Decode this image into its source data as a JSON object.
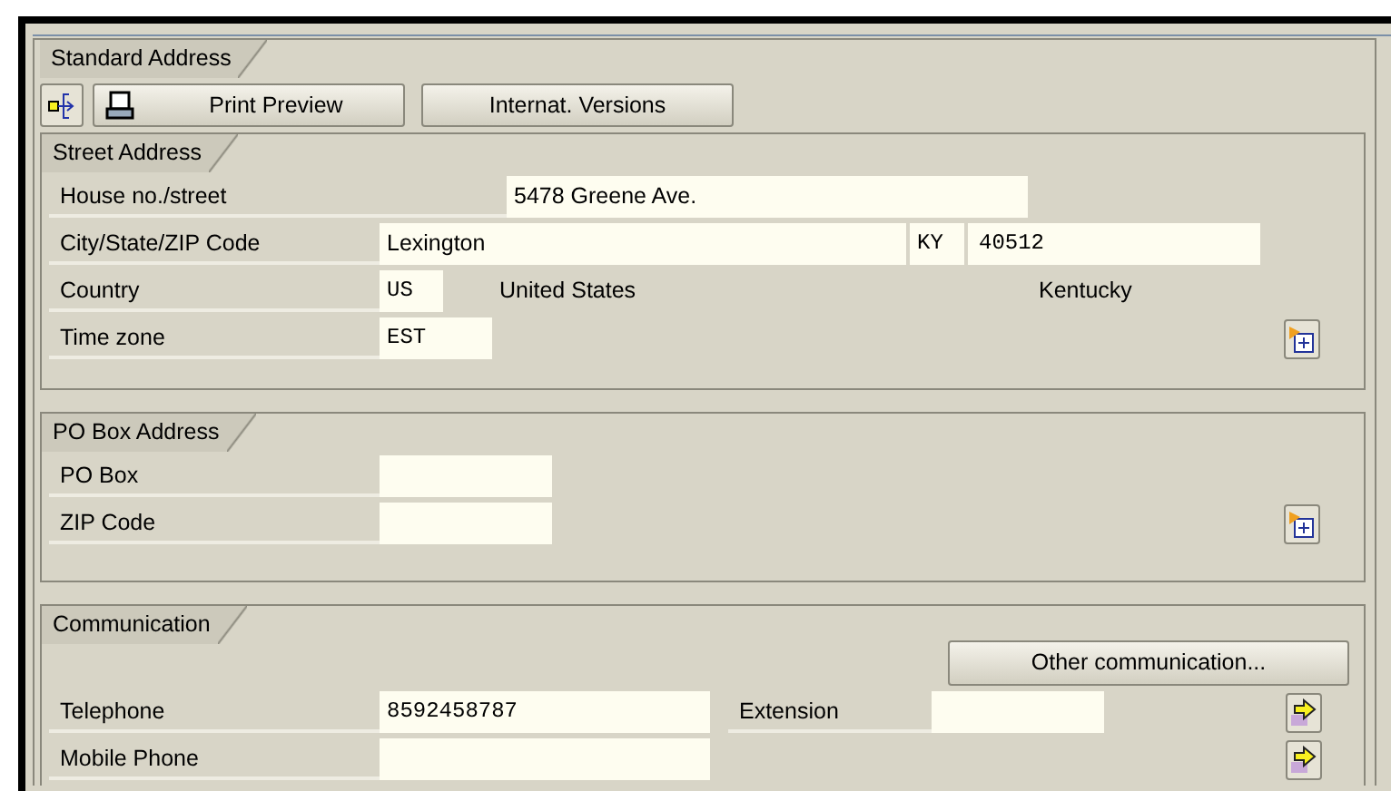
{
  "standard_address": {
    "title": "Standard Address",
    "print_preview": "Print Preview",
    "internat_versions": "Internat. Versions"
  },
  "street_address": {
    "title": "Street Address",
    "house_street": {
      "label": "House no./street",
      "value": "5478 Greene Ave."
    },
    "city_state_zip": {
      "label": "City/State/ZIP Code",
      "city": "Lexington",
      "state": "KY",
      "zip": "40512"
    },
    "country": {
      "label": "Country",
      "code": "US",
      "name": "United States",
      "region": "Kentucky"
    },
    "time_zone": {
      "label": "Time zone",
      "value": "EST"
    }
  },
  "po_box_address": {
    "title": "PO Box Address",
    "rows": [
      {
        "label": "PO Box"
      },
      {
        "label": "ZIP Code"
      }
    ]
  },
  "communication": {
    "title": "Communication",
    "other_button": "Other communication...",
    "rows": [
      {
        "label": "Telephone",
        "value": "8592458787",
        "extension_label": "Extension"
      },
      {
        "label": "Mobile Phone"
      }
    ]
  }
}
